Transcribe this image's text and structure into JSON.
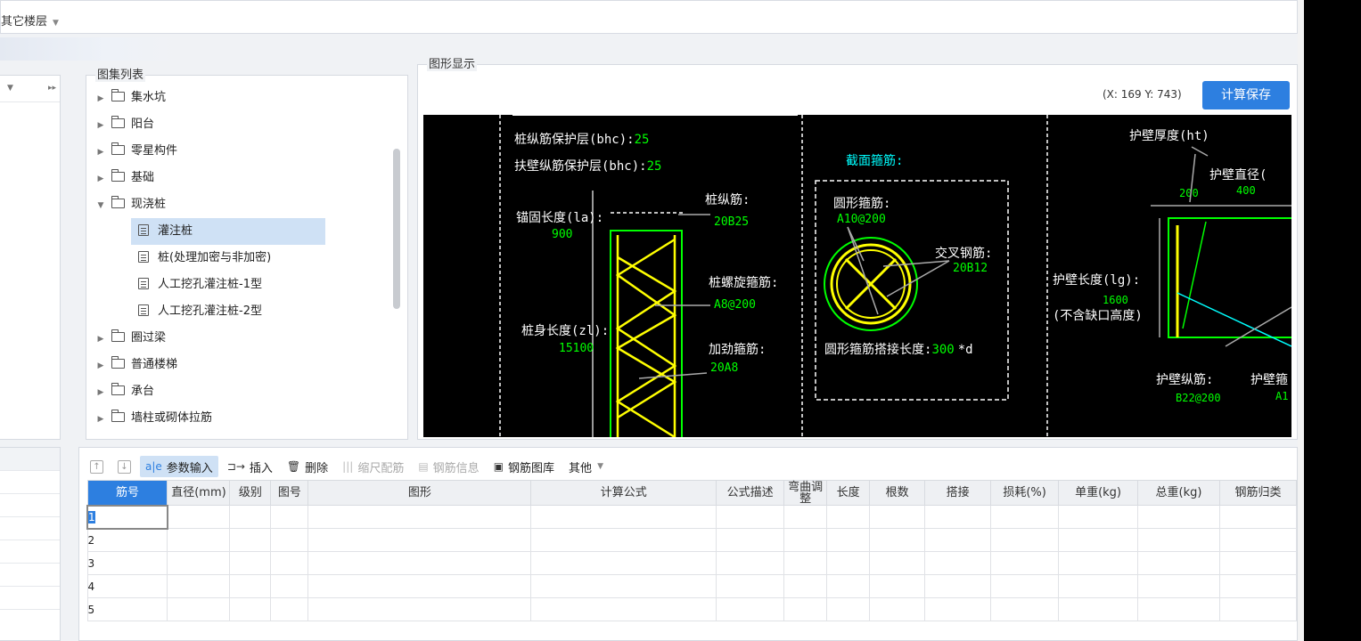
{
  "topbar": {
    "floor_label": "其它楼层"
  },
  "tree": {
    "title": "图集列表",
    "items": [
      {
        "label": "集水坑",
        "type": "folder",
        "expanded": false
      },
      {
        "label": "阳台",
        "type": "folder",
        "expanded": false
      },
      {
        "label": "零星构件",
        "type": "folder",
        "expanded": false
      },
      {
        "label": "基础",
        "type": "folder",
        "expanded": false
      },
      {
        "label": "现浇桩",
        "type": "folder",
        "expanded": true
      },
      {
        "label": "灌注桩",
        "type": "doc",
        "selected": true
      },
      {
        "label": "桩(处理加密与非加密)",
        "type": "doc"
      },
      {
        "label": "人工挖孔灌注桩-1型",
        "type": "doc"
      },
      {
        "label": "人工挖孔灌注桩-2型",
        "type": "doc"
      },
      {
        "label": "圈过梁",
        "type": "folder",
        "expanded": false
      },
      {
        "label": "普通楼梯",
        "type": "folder",
        "expanded": false
      },
      {
        "label": "承台",
        "type": "folder",
        "expanded": false
      },
      {
        "label": "墙柱或砌体拉筋",
        "type": "folder",
        "expanded": false
      }
    ]
  },
  "graphic": {
    "title": "图形显示",
    "coord": "(X: 169 Y: 743)",
    "save_button": "计算保存",
    "drawing": {
      "t1_label": "桩纵筋保护层(bhc):",
      "t1_val": "25",
      "t2_label": "扶壁纵筋保护层(bhc):",
      "t2_val": "25",
      "anchor_label": "锚固长度(la):",
      "anchor_val": "900",
      "main_bar_label": "桩纵筋:",
      "main_bar_val": "20B25",
      "spiral_label": "桩螺旋箍筋:",
      "spiral_val": "A8@200",
      "body_label": "桩身长度(zl):",
      "body_val": "15100",
      "stiff_label": "加劲箍筋:",
      "stiff_val": "20A8",
      "section_title": "截面箍筋:",
      "circ_label": "圆形箍筋:",
      "circ_val": "A10@200",
      "cross_label": "交叉钢筋:",
      "cross_val": "20B12",
      "lap_label": "圆形箍筋搭接长度:",
      "lap_val": "300",
      "lap_unit": "*d",
      "wall_thk_label": "护壁厚度(ht)",
      "wall_thk_val": "200",
      "wall_dia_label": "护壁直径(",
      "wall_dia_val": "400",
      "wall_len_label": "护壁长度(lg):",
      "wall_len_val": "1600",
      "wall_len_note": "(不含缺口高度)",
      "wall_bar_label": "护壁纵筋:",
      "wall_bar_val": "B22@200",
      "wall_stir_label": "护壁箍",
      "wall_stir_val": "A1"
    }
  },
  "toolbar": {
    "param_input": "参数输入",
    "insert": "插入",
    "delete": "删除",
    "scale_bar": "缩尺配筋",
    "bar_info": "钢筋信息",
    "bar_library": "钢筋图库",
    "other": "其他"
  },
  "grid": {
    "columns": [
      "筋号",
      "直径(mm)",
      "级别",
      "图号",
      "图形",
      "计算公式",
      "公式描述",
      "弯曲调整",
      "长度",
      "根数",
      "搭接",
      "损耗(%)",
      "单重(kg)",
      "总重(kg)",
      "钢筋归类"
    ],
    "rows": [
      "1",
      "2",
      "3",
      "4",
      "5"
    ]
  },
  "colors": {
    "accent": "#2d7fe0",
    "canvas_bg": "#000000",
    "rebar_yellow": "#ffff00",
    "rebar_green": "#00ff00",
    "value_green": "#00ff00",
    "cyan": "#00ffff"
  }
}
